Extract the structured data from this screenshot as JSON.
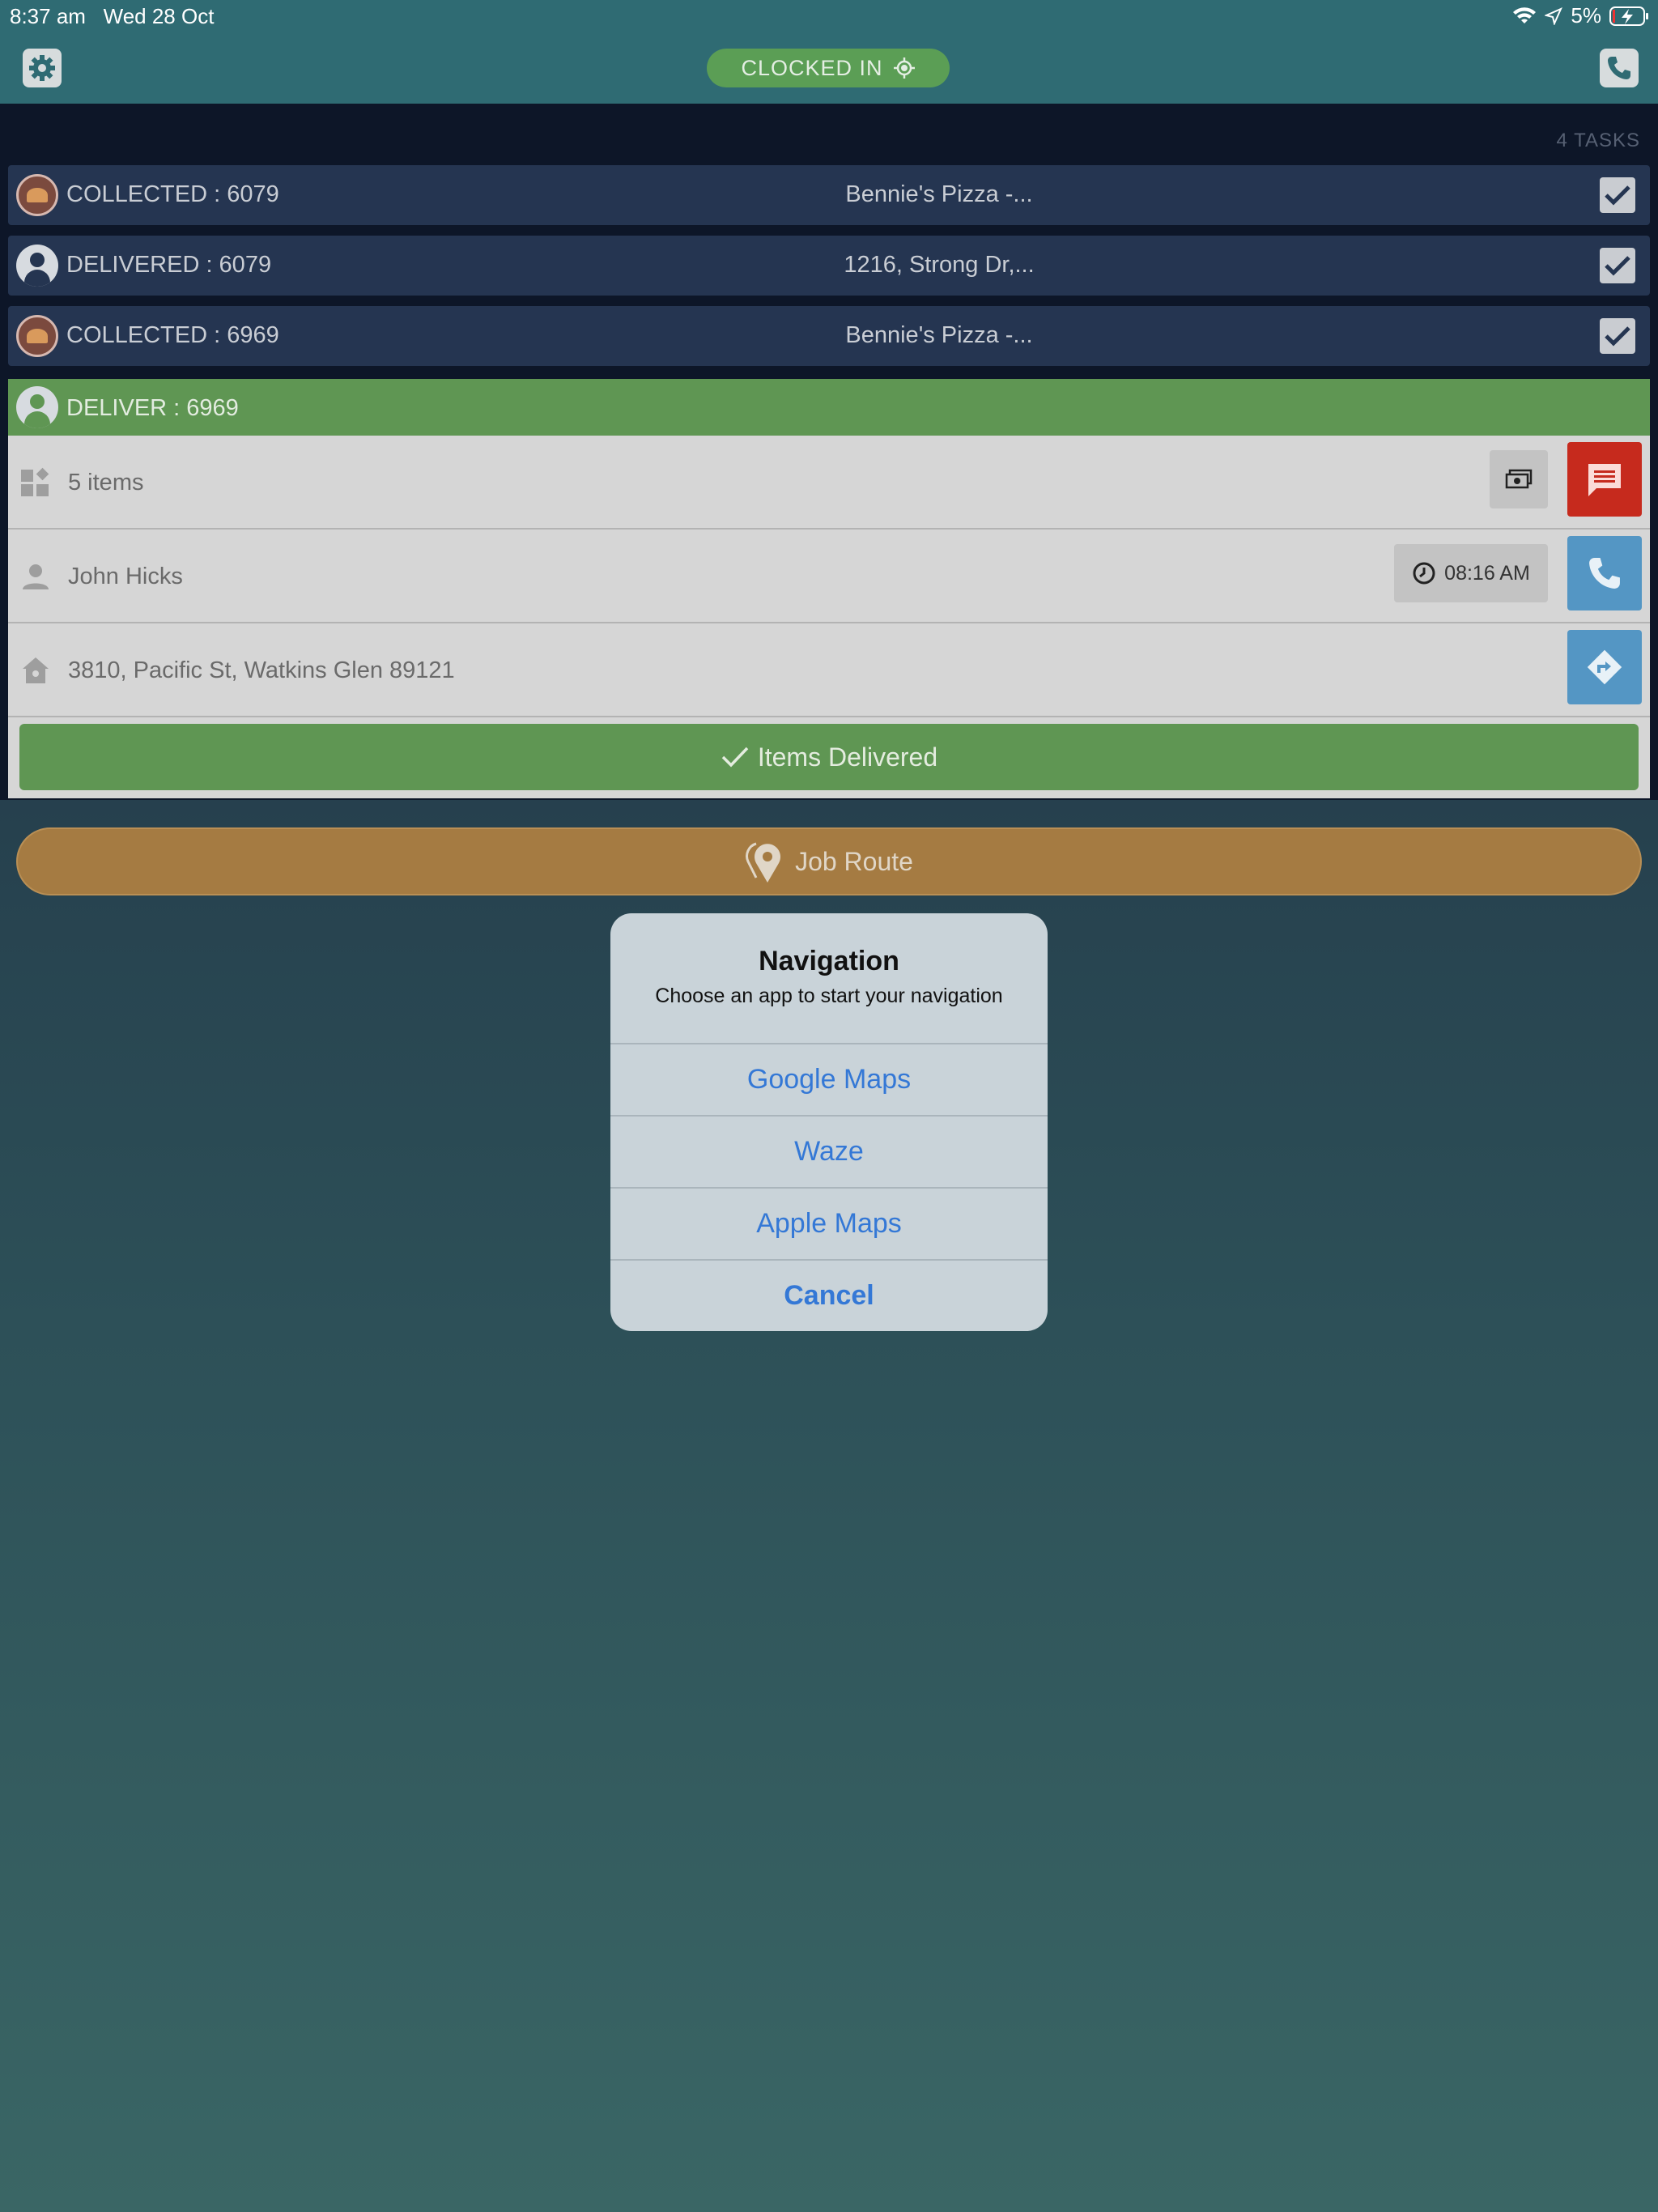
{
  "status_bar": {
    "time": "8:37 am",
    "date": "Wed 28 Oct",
    "battery": "5%"
  },
  "header": {
    "clock_status": "CLOCKED IN"
  },
  "tasks": {
    "count_label": "4 TASKS",
    "completed": [
      {
        "label": "COLLECTED : 6079",
        "place": "Bennie's Pizza -...",
        "avatar": "pizza-icon"
      },
      {
        "label": "DELIVERED : 6079",
        "place": "1216, Strong Dr,...",
        "avatar": "person-icon"
      },
      {
        "label": "COLLECTED : 6969",
        "place": "Bennie's Pizza -...",
        "avatar": "pizza-icon"
      }
    ],
    "active": {
      "label": "DELIVER : 6969",
      "items": "5 items",
      "customer": "John Hicks",
      "time": "08:16 AM",
      "address": "3810, Pacific St, Watkins Glen 89121",
      "delivered_button": "Items Delivered"
    }
  },
  "job_route_button": "Job Route",
  "dialog": {
    "title": "Navigation",
    "subtitle": "Choose an app to start your navigation",
    "options": [
      "Google Maps",
      "Waze",
      "Apple Maps"
    ],
    "cancel": "Cancel"
  },
  "colors": {
    "accent_green": "#5f9653",
    "chat_red": "#c62a1d",
    "action_blue": "#5496c4",
    "route_orange": "#a57b42",
    "link_blue": "#3478d6"
  }
}
